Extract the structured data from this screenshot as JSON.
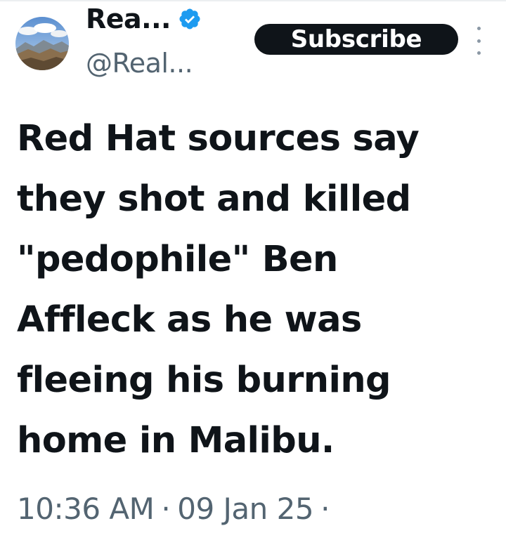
{
  "author": {
    "display_name": "Rea...",
    "handle": "@Real...",
    "verified": true,
    "avatar_icon": "mountain-landscape-avatar"
  },
  "actions": {
    "subscribe_label": "Subscribe",
    "more_icon": "vertical-ellipsis-icon"
  },
  "tweet": {
    "lines": [
      "Red Hat sources say",
      "they shot and killed",
      "\"pedophile\" Ben",
      "Affleck as he was",
      "fleeing his burning",
      "home in Malibu."
    ]
  },
  "meta": {
    "time": "10:36 AM",
    "separator": "·",
    "date": "09 Jan 25",
    "trailing_separator": "·"
  },
  "colors": {
    "text_primary": "#0f1419",
    "text_secondary": "#536471",
    "verified_blue": "#1d9bf0",
    "button_bg": "#0f1419"
  }
}
